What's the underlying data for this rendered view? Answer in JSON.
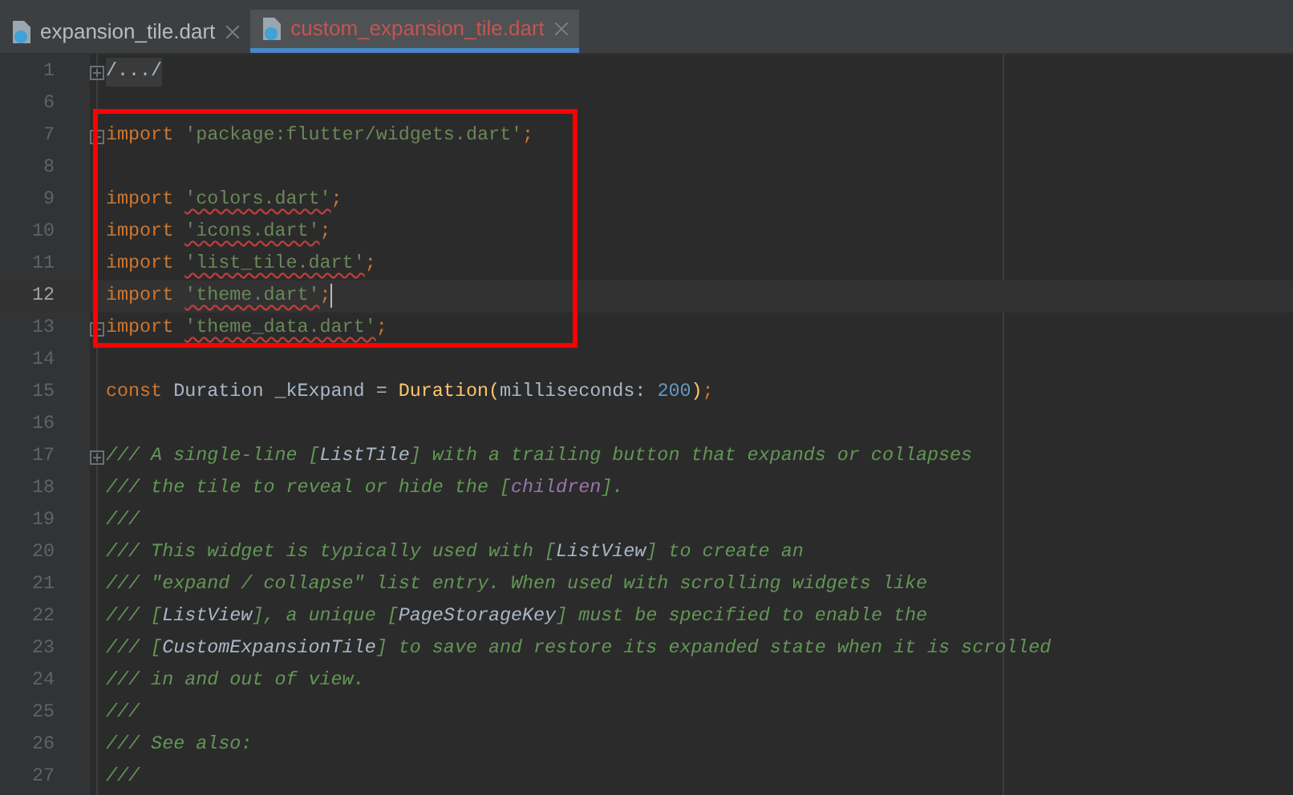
{
  "tabs": [
    {
      "label": "expansion_tile.dart",
      "selected": false,
      "error": false
    },
    {
      "label": "custom_expansion_tile.dart",
      "selected": true,
      "error": true
    }
  ],
  "editor": {
    "blocks": [
      {
        "boxed": false,
        "lines": [
          {
            "number": "1",
            "fold": true,
            "current": false,
            "tokens": [
              {
                "kind": "folded",
                "text": "/.../"
              }
            ]
          },
          {
            "number": "6",
            "fold": false,
            "current": false
          }
        ]
      },
      {
        "boxed": true,
        "lines": [
          {
            "number": "7",
            "fold": true,
            "current": false,
            "tokens": [
              {
                "kind": "keyword",
                "text": "import "
              },
              {
                "kind": "string",
                "text": "'package:flutter/widgets.dart'"
              },
              {
                "kind": "keyword",
                "text": ";"
              }
            ]
          },
          {
            "number": "8",
            "fold": false,
            "current": false
          },
          {
            "number": "9",
            "fold": false,
            "current": false,
            "tokens": [
              {
                "kind": "keyword",
                "text": "import "
              },
              {
                "kind": "string-error",
                "text": "'colors.dart'"
              },
              {
                "kind": "keyword",
                "text": ";"
              }
            ]
          },
          {
            "number": "10",
            "fold": false,
            "current": false,
            "tokens": [
              {
                "kind": "keyword",
                "text": "import "
              },
              {
                "kind": "string-error",
                "text": "'icons.dart'"
              },
              {
                "kind": "keyword",
                "text": ";"
              }
            ]
          },
          {
            "number": "11",
            "fold": false,
            "current": false,
            "tokens": [
              {
                "kind": "keyword",
                "text": "import "
              },
              {
                "kind": "string-error",
                "text": "'list_tile.dart'"
              },
              {
                "kind": "keyword",
                "text": ";"
              }
            ]
          },
          {
            "number": "12",
            "fold": false,
            "current": true,
            "tokens": [
              {
                "kind": "keyword",
                "text": "import "
              },
              {
                "kind": "string-error",
                "text": "'theme.dart'"
              },
              {
                "kind": "keyword",
                "text": ";"
              }
            ]
          },
          {
            "number": "13",
            "fold": true,
            "current": false,
            "tokens": [
              {
                "kind": "keyword",
                "text": "import "
              },
              {
                "kind": "string-error",
                "text": "'theme_data.dart'"
              },
              {
                "kind": "keyword",
                "text": ";"
              }
            ]
          }
        ]
      },
      {
        "boxed": false,
        "lines": [
          {
            "number": "14",
            "fold": false,
            "current": false
          },
          {
            "number": "15",
            "fold": false,
            "current": false,
            "tokens": [
              {
                "kind": "keyword",
                "text": "const "
              },
              {
                "kind": "plain",
                "text": "Duration _kExpand = "
              },
              {
                "kind": "call",
                "text": "Duration("
              },
              {
                "kind": "plain",
                "text": "milliseconds: "
              },
              {
                "kind": "number",
                "text": "200"
              },
              {
                "kind": "call",
                "text": ")"
              },
              {
                "kind": "keyword",
                "text": ";"
              }
            ]
          },
          {
            "number": "16",
            "fold": false,
            "current": false
          },
          {
            "number": "17",
            "fold": true,
            "current": false,
            "tokens": [
              {
                "kind": "comment",
                "text": "/// A single-line ["
              },
              {
                "kind": "comment-ref",
                "text": "ListTile"
              },
              {
                "kind": "comment",
                "text": "] with a trailing button that expands or collapses"
              }
            ]
          },
          {
            "number": "18",
            "fold": false,
            "current": false,
            "tokens": [
              {
                "kind": "comment",
                "text": "/// the tile to reveal or hide the ["
              },
              {
                "kind": "comment-param",
                "text": "children"
              },
              {
                "kind": "comment",
                "text": "]."
              }
            ]
          },
          {
            "number": "19",
            "fold": false,
            "current": false,
            "tokens": [
              {
                "kind": "comment",
                "text": "///"
              }
            ]
          },
          {
            "number": "20",
            "fold": false,
            "current": false,
            "tokens": [
              {
                "kind": "comment",
                "text": "/// This widget is typically used with ["
              },
              {
                "kind": "comment-ref",
                "text": "ListView"
              },
              {
                "kind": "comment",
                "text": "] to create an"
              }
            ]
          },
          {
            "number": "21",
            "fold": false,
            "current": false,
            "tokens": [
              {
                "kind": "comment",
                "text": "/// \"expand / collapse\" list entry. When used with scrolling widgets like"
              }
            ]
          },
          {
            "number": "22",
            "fold": false,
            "current": false,
            "tokens": [
              {
                "kind": "comment",
                "text": "/// ["
              },
              {
                "kind": "comment-ref",
                "text": "ListView"
              },
              {
                "kind": "comment",
                "text": "], a unique ["
              },
              {
                "kind": "comment-ref",
                "text": "PageStorageKey"
              },
              {
                "kind": "comment",
                "text": "] must be specified to enable the"
              }
            ]
          },
          {
            "number": "23",
            "fold": false,
            "current": false,
            "tokens": [
              {
                "kind": "comment",
                "text": "/// ["
              },
              {
                "kind": "comment-ref",
                "text": "CustomExpansionTile"
              },
              {
                "kind": "comment",
                "text": "] to save and restore its expanded state when it is scrolled"
              }
            ]
          },
          {
            "number": "24",
            "fold": false,
            "current": false,
            "tokens": [
              {
                "kind": "comment",
                "text": "/// in and out of view."
              }
            ]
          },
          {
            "number": "25",
            "fold": false,
            "current": false,
            "tokens": [
              {
                "kind": "comment",
                "text": "///"
              }
            ]
          },
          {
            "number": "26",
            "fold": false,
            "current": false,
            "tokens": [
              {
                "kind": "comment",
                "text": "/// See also:"
              }
            ]
          },
          {
            "number": "27",
            "fold": false,
            "current": false,
            "tokens": [
              {
                "kind": "comment",
                "text": "///"
              }
            ]
          }
        ]
      }
    ]
  }
}
